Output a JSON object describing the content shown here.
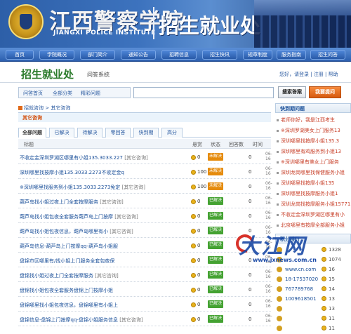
{
  "header": {
    "school_cn": "江西警察学院",
    "school_en": "JIANGXI POLICE INSTITUTE",
    "office": "招生就业处"
  },
  "nav": {
    "items": [
      "首页",
      "学院概况",
      "部门简介",
      "通知公告",
      "招聘信息",
      "招生快讯",
      "规章制度",
      "服务指南",
      "招生问答"
    ]
  },
  "subheader": {
    "title": "招生就业处",
    "system": "问答系统",
    "user_links": "您好，请登录 | 注册 | 帮助"
  },
  "toolbar": {
    "tabs": [
      "问答首页",
      "全部分类",
      "精彩问题"
    ],
    "search_placeholder": "",
    "search_button": "搜索答案",
    "ask_button": "我要提问"
  },
  "breadcrumb": {
    "home": "招就咨询",
    "current": "其它咨询"
  },
  "category": {
    "title": "其它咨询"
  },
  "filter_tabs": [
    "全部问题",
    "已解决",
    "待解决",
    "零回答",
    "快到期",
    "高分"
  ],
  "table": {
    "headers": [
      "标题",
      "悬赏",
      "状态",
      "回答数",
      "时间"
    ],
    "rows": [
      {
        "title": "不收定金深圳罗湖区哪里有小姐135.3033.227",
        "cat": "[其它咨询]",
        "score": "0",
        "status": "未解决",
        "status_type": "open",
        "answers": "0",
        "time": "06-16"
      },
      {
        "title": "深圳哪里找按摩小姐135.3033.2273不收定金q",
        "cat": "",
        "score": "100",
        "status": "未解决",
        "status_type": "open",
        "answers": "0",
        "time": "06-16"
      },
      {
        "title": "※深圳哪里找服务到小姐135.3033.2273免定",
        "cat": "[其它咨询]",
        "score": "100",
        "status": "未解决",
        "status_type": "open",
        "answers": "0",
        "time": "06-16"
      },
      {
        "title": "葫芦岛找小姐过夜上门全套按摩服务",
        "cat": "[其它咨询]",
        "score": "0",
        "status": "已解决",
        "status_type": "solved",
        "answers": "0",
        "time": "06-16"
      },
      {
        "title": "葫芦岛找小姐包夜全套服务葫芦岛上门按摩",
        "cat": "[其它咨询]",
        "score": "0",
        "status": "已解决",
        "status_type": "solved",
        "answers": "0",
        "time": "06-16"
      },
      {
        "title": "葫芦岛找小姐包夜信息，葫芦岛哪里有小",
        "cat": "[其它咨询]",
        "score": "0",
        "status": "已解决",
        "status_type": "solved",
        "answers": "0",
        "time": "06-16"
      },
      {
        "title": "葫芦岛信息-葫芦岛上门按摩qq-葫芦岛小姐服",
        "cat": "",
        "score": "0",
        "status": "已解决",
        "status_type": "solved",
        "answers": "0",
        "time": "06-16"
      },
      {
        "title": "盘锦市区哪里有/找小姐上门服务全套包夜保",
        "cat": "",
        "score": "0",
        "status": "已解决",
        "status_type": "solved",
        "answers": "0",
        "time": "06-16"
      },
      {
        "title": "盘锦找小姐过夜上门全套按摩服务",
        "cat": "[其它咨询]",
        "score": "0",
        "status": "已解决",
        "status_type": "solved",
        "answers": "0",
        "time": "06-16"
      },
      {
        "title": "盘锦找小姐包夜全套服务盘锦上门按摩小姐",
        "cat": "",
        "score": "0",
        "status": "已解决",
        "status_type": "solved",
        "answers": "0",
        "time": "06-16"
      },
      {
        "title": "盘锦哪里找小姐包夜信息，盘锦哪里有小姐上",
        "cat": "",
        "score": "0",
        "status": "已解决",
        "status_type": "solved",
        "answers": "0",
        "time": "06-16"
      },
      {
        "title": "盘锦信息-盘锦上门按摩qq-盘锦小姐服务信息",
        "cat": "[其它咨询]",
        "score": "0",
        "status": "已解决",
        "status_type": "solved",
        "answers": "0",
        "time": "06-16"
      }
    ]
  },
  "sidebar": {
    "title": "快到期问题",
    "items": [
      "老师你好，我是江西考生",
      "※深圳罗湖美女上门服务13",
      "深圳哪里找按摩小姐135.3",
      "深圳哪里有鸡服务到小姐13",
      "※深圳哪里有美女上门服务",
      "深圳龙岗哪里找保健服务小姐",
      "深圳哪里找按摩小姐135",
      "深圳哪里找按摩服务小姐1",
      "深圳龙岗找按摩服务小姐15771",
      "不收定金深圳罗湖区哪里有小",
      "北京哪里有按摩全部服务小姐"
    ],
    "rank_title": "积分排行",
    "rank": [
      {
        "name": "",
        "score": "1328"
      },
      {
        "name": "",
        "score": "1074"
      },
      {
        "name": "",
        "score": "16"
      },
      {
        "name": "",
        "score": "15"
      },
      {
        "name": "",
        "score": "14"
      },
      {
        "name": "",
        "score": "13"
      },
      {
        "name": "",
        "score": "13"
      },
      {
        "name": "",
        "score": "11"
      },
      {
        "name": "",
        "score": "11"
      }
    ],
    "rank_names": [
      "",
      "",
      "www.cn.com",
      "18-17537020",
      "767789768",
      "1009618501",
      "",
      "",
      ""
    ]
  },
  "watermark": {
    "brand": "大江网",
    "url": "www.jxnews.com.cn"
  }
}
